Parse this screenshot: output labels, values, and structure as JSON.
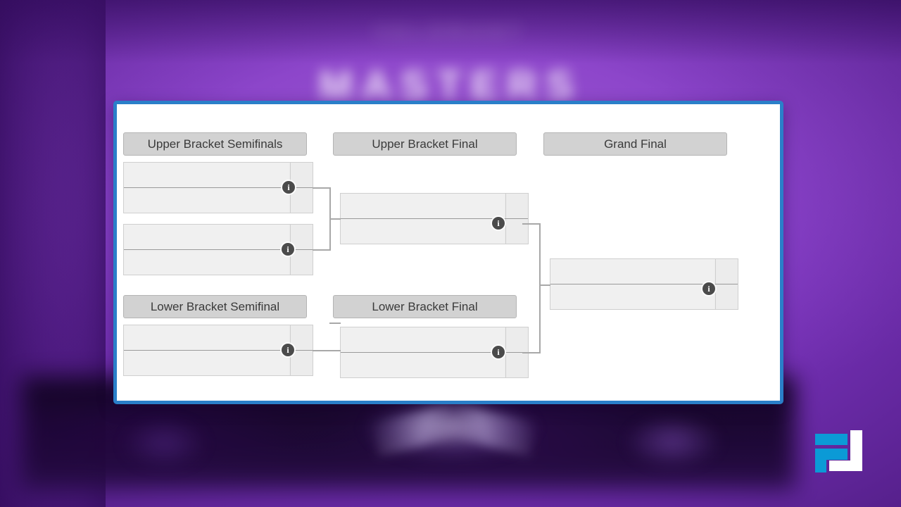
{
  "background": {
    "event_title": "MASTERS",
    "event_subtitle": "VALORANT",
    "base_color": "#8a43c9",
    "accent_color": "#2a7fc9"
  },
  "panel": {
    "border_color": "#2a7fc9",
    "background_color": "#ffffff"
  },
  "bracket": {
    "type": "double-elimination",
    "rounds": [
      {
        "id": "upper-bracket-semifinals",
        "label": "Upper Bracket Semifinals",
        "matches": [
          {
            "id": "ubsf-1",
            "team_top": "",
            "team_bottom": "",
            "score_top": "",
            "score_bottom": "",
            "info_label": "i"
          },
          {
            "id": "ubsf-2",
            "team_top": "",
            "team_bottom": "",
            "score_top": "",
            "score_bottom": "",
            "info_label": "i"
          }
        ]
      },
      {
        "id": "upper-bracket-final",
        "label": "Upper Bracket Final",
        "matches": [
          {
            "id": "ubf-1",
            "team_top": "",
            "team_bottom": "",
            "score_top": "",
            "score_bottom": "",
            "info_label": "i"
          }
        ]
      },
      {
        "id": "grand-final",
        "label": "Grand Final",
        "matches": [
          {
            "id": "gf-1",
            "team_top": "",
            "team_bottom": "",
            "score_top": "",
            "score_bottom": "",
            "info_label": "i"
          }
        ]
      },
      {
        "id": "lower-bracket-semifinal",
        "label": "Lower Bracket Semifinal",
        "matches": [
          {
            "id": "lbsf-1",
            "team_top": "",
            "team_bottom": "",
            "score_top": "",
            "score_bottom": "",
            "info_label": "i"
          }
        ]
      },
      {
        "id": "lower-bracket-final",
        "label": "Lower Bracket Final",
        "matches": [
          {
            "id": "lbf-1",
            "team_top": "",
            "team_bottom": "",
            "score_top": "",
            "score_bottom": "",
            "info_label": "i"
          }
        ]
      }
    ]
  },
  "logo": {
    "name": "fj-watermark-logo",
    "primary_color": "#0b9ad6",
    "secondary_color": "#ffffff"
  }
}
